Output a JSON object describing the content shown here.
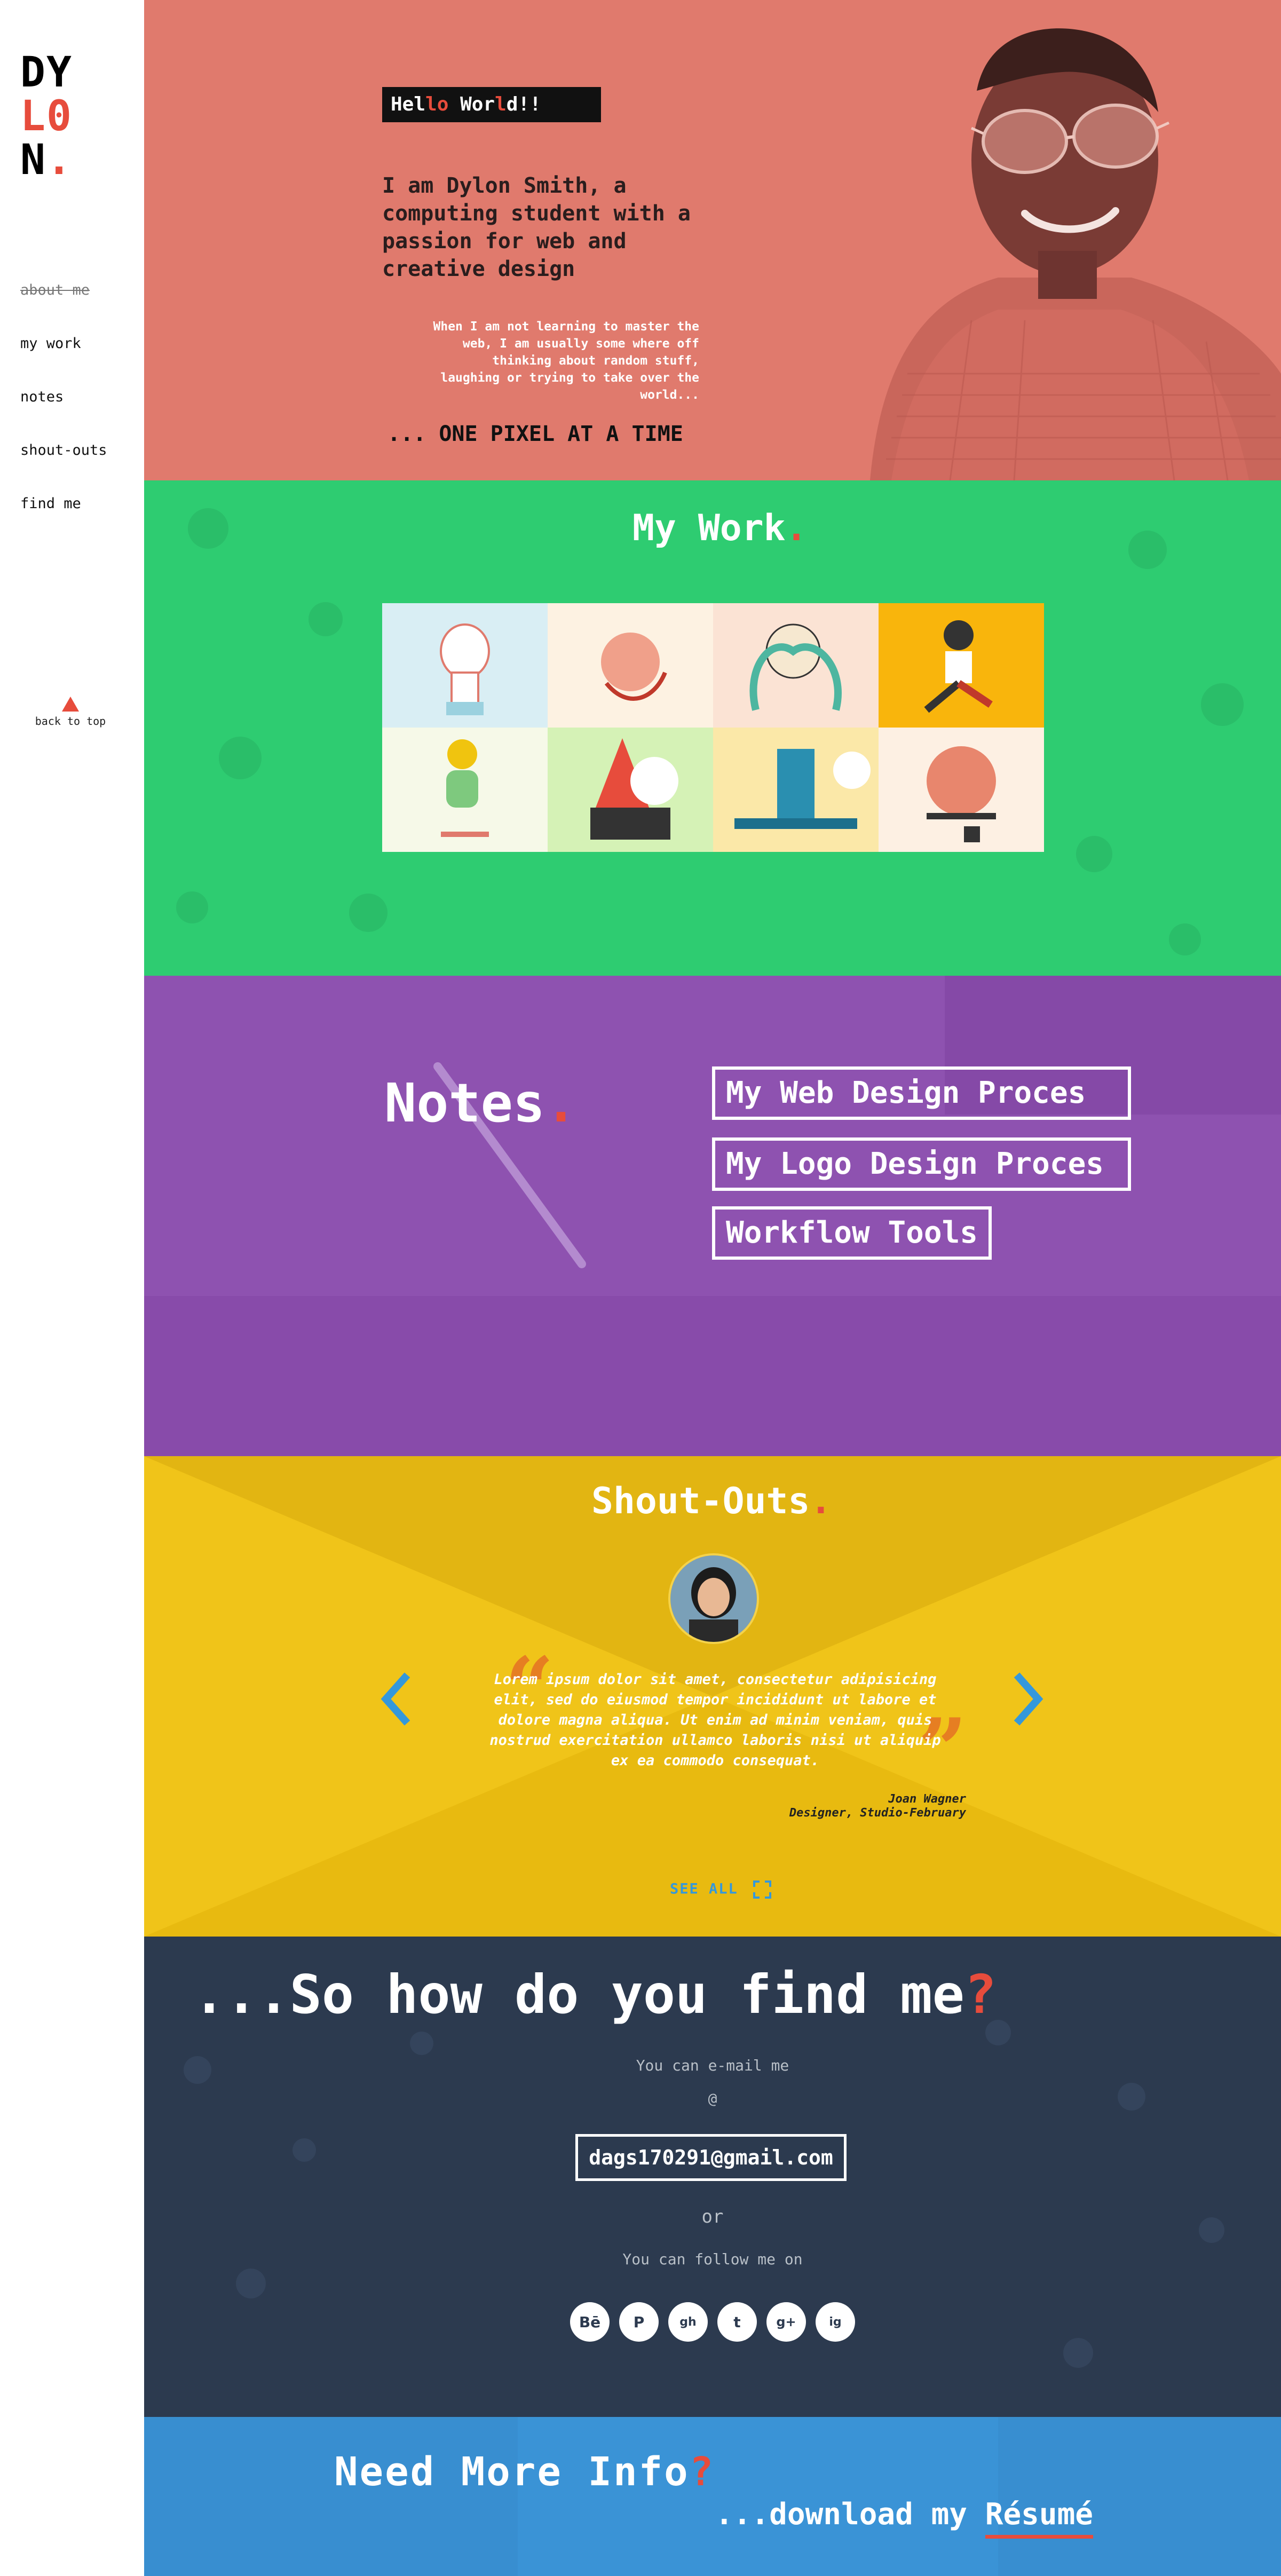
{
  "brand": {
    "line1": "DY",
    "line2": "L0",
    "line3": "N",
    "dot": "."
  },
  "nav": {
    "items": [
      "about me",
      "my work",
      "notes",
      "shout-outs",
      "find me"
    ],
    "back_to_top": "back to top"
  },
  "hero": {
    "hello": [
      "Hel",
      "lo",
      " Wor",
      "l",
      "d!!"
    ],
    "intro": "I am Dylon Smith, a computing student with a passion for web and creative design",
    "aside": "When I am not learning to master the web, I am usually some where off thinking about random stuff, laughing or trying to take over the world...",
    "tagline": "... ONE PIXEL AT A TIME"
  },
  "work": {
    "title": "My Work",
    "dot": "."
  },
  "notes": {
    "title": "Notes",
    "dot": ".",
    "links": [
      "My Web Design Proces",
      "My Logo Design Proces",
      "Workflow Tools"
    ]
  },
  "shoutouts": {
    "title": "Shout-Outs",
    "dot": ".",
    "quote": "Lorem ipsum dolor sit amet, consectetur adipisicing elit, sed do eiusmod tempor incididunt ut labore et dolore magna aliqua. Ut enim ad minim veniam, quis nostrud exercitation ullamco laboris nisi ut aliquip ex ea commodo consequat.",
    "author_name": "Joan Wagner",
    "author_role": "Designer, Studio-February",
    "see_all": "SEE ALL"
  },
  "find": {
    "title": "...So how do you find me",
    "qmark": "?",
    "email_prompt": "You can e-mail me",
    "at": "@",
    "email": "dags170291@gmail.com",
    "or": "or",
    "follow": "You can follow me on",
    "socials": [
      "Bē",
      "P",
      "gh",
      "t",
      "g+",
      "ig"
    ]
  },
  "info": {
    "title": "Need More Info",
    "qmark": "?",
    "download_prefix": "...download my ",
    "resume": "Résumé"
  },
  "colors": {
    "accent": "#e74c3c",
    "hero": "#e07a6d",
    "work": "#2ecc71",
    "notes": "#8e52b0",
    "shout": "#e8ba10",
    "find": "#2c3a4f",
    "info": "#3a93d6"
  }
}
